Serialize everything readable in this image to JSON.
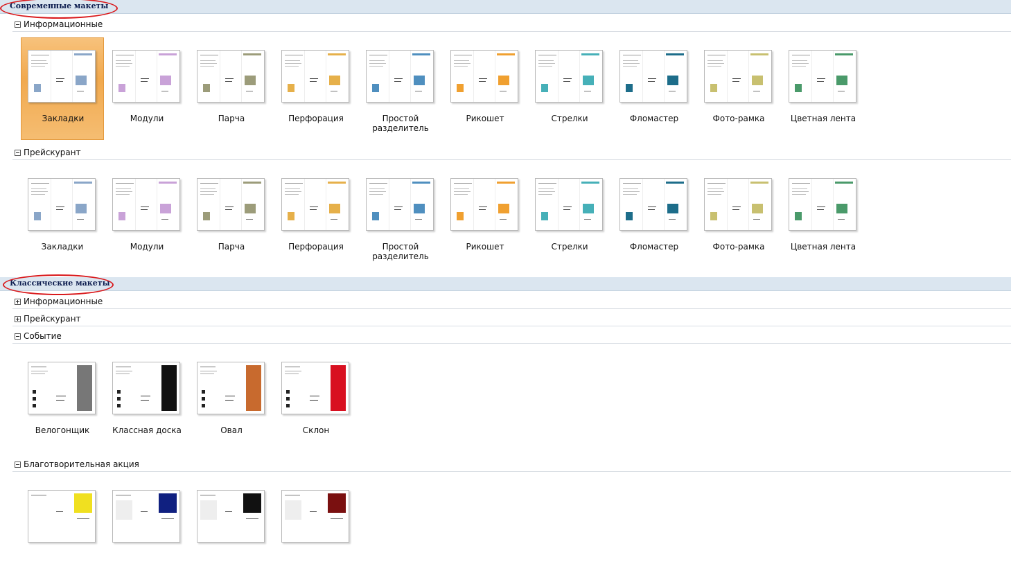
{
  "sections": [
    {
      "title": "Современные макеты",
      "groups": [
        {
          "label": "Информационные",
          "expanded": true,
          "items": [
            "Закладки",
            "Модули",
            "Парча",
            "Перфорация",
            "Простой разделитель",
            "Рикошет",
            "Стрелки",
            "Фломастер",
            "Фото-рамка",
            "Цветная лента"
          ],
          "selected": "Закладки"
        },
        {
          "label": "Прейскурант",
          "expanded": true,
          "items": [
            "Закладки",
            "Модули",
            "Парча",
            "Перфорация",
            "Простой разделитель",
            "Рикошет",
            "Стрелки",
            "Фломастер",
            "Фото-рамка",
            "Цветная лента"
          ]
        }
      ]
    },
    {
      "title": "Классические макеты",
      "groups": [
        {
          "label": "Информационные",
          "expanded": false
        },
        {
          "label": "Прейскурант",
          "expanded": false
        },
        {
          "label": "Событие",
          "expanded": true,
          "items": [
            "Велогонщик",
            "Классная доска",
            "Овал",
            "Склон"
          ]
        },
        {
          "label": "Благотворительная акция",
          "expanded": true,
          "items": [
            "",
            "",
            "",
            ""
          ]
        }
      ]
    }
  ],
  "colors": {
    "band": "#dbe6f0",
    "selected": "#f1a94e",
    "highlight_oval": "#d9191c"
  }
}
